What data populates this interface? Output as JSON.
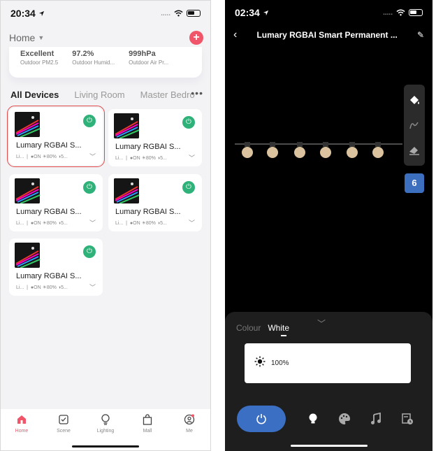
{
  "left": {
    "status": {
      "time": "20:34"
    },
    "home": {
      "title": "Home"
    },
    "weather": [
      {
        "value": "Excellent",
        "label": "Outdoor PM2.5"
      },
      {
        "value": "97.2%",
        "label": "Outdoor Humid..."
      },
      {
        "value": "999hPa",
        "label": "Outdoor Air Pr..."
      }
    ],
    "tabs": [
      "All Devices",
      "Living Room",
      "Master Bedro"
    ],
    "devices": [
      {
        "name": "Lumary RGBAI S...",
        "room": "Li...",
        "state": "ON",
        "brightness": "80%",
        "extra": "5..."
      },
      {
        "name": "Lumary RGBAI S...",
        "room": "Li...",
        "state": "ON",
        "brightness": "80%",
        "extra": "5..."
      },
      {
        "name": "Lumary RGBAI S...",
        "room": "Li...",
        "state": "ON",
        "brightness": "80%",
        "extra": "5..."
      },
      {
        "name": "Lumary RGBAI S...",
        "room": "Li...",
        "state": "ON",
        "brightness": "80%",
        "extra": "5..."
      },
      {
        "name": "Lumary RGBAI S...",
        "room": "Li...",
        "state": "ON",
        "brightness": "80%",
        "extra": "5..."
      }
    ],
    "tabbar": [
      "Home",
      "Scene",
      "Lighting",
      "Mall",
      "Me"
    ]
  },
  "right": {
    "status": {
      "time": "02:34"
    },
    "title": "Lumary RGBAI Smart Permanent ...",
    "bulb_count": "6",
    "modes": [
      "Colour",
      "White"
    ],
    "brightness": "100%"
  },
  "colors": {
    "accent_red": "#f0556a",
    "power_green": "#2fb27a",
    "accent_blue": "#3b6fc4"
  }
}
